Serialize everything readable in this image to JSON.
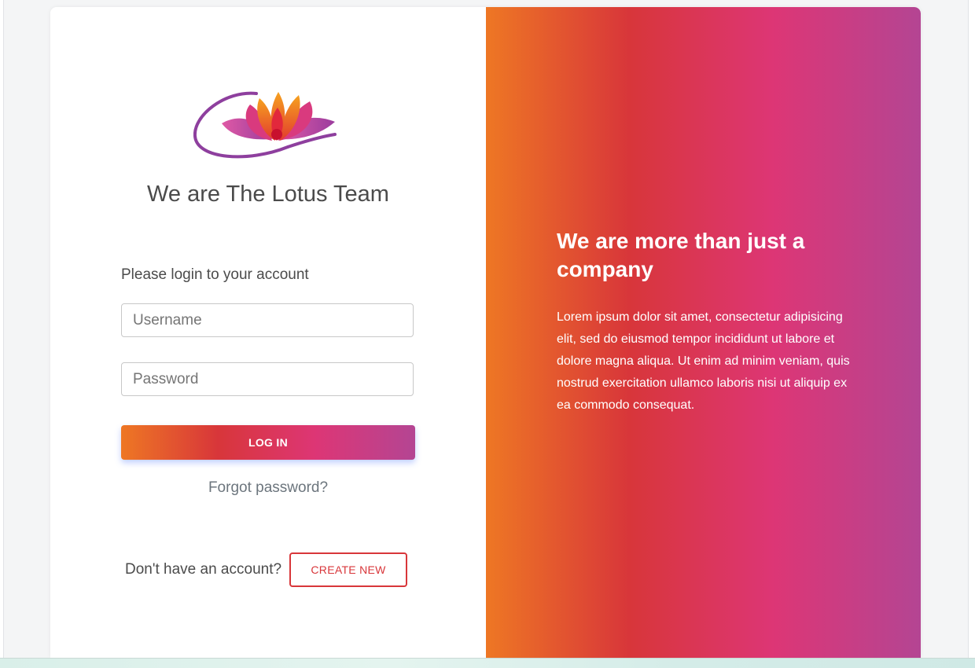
{
  "brand": {
    "title": "We are The Lotus Team",
    "logo_icon": "lotus-flower-icon"
  },
  "login": {
    "prompt": "Please login to your account",
    "username_placeholder": "Username",
    "password_placeholder": "Password",
    "login_button_label": "LOG IN",
    "forgot_link": "Forgot password?",
    "signup_text": "Don't have an account?",
    "create_button_label": "CREATE NEW"
  },
  "promo": {
    "heading": "We are more than just a company",
    "body": "Lorem ipsum dolor sit amet, consectetur adipisicing elit, sed do eiusmod tempor incididunt ut labore et dolore magna aliqua. Ut enim ad minim veniam, quis nostrud exercitation ullamco laboris nisi ut aliquip ex ea commodo consequat."
  },
  "colors": {
    "gradient": [
      "#ee7724",
      "#d8363a",
      "#dd3675",
      "#b44593"
    ],
    "accent": "#d8363a",
    "text": "#4b4b4b"
  }
}
